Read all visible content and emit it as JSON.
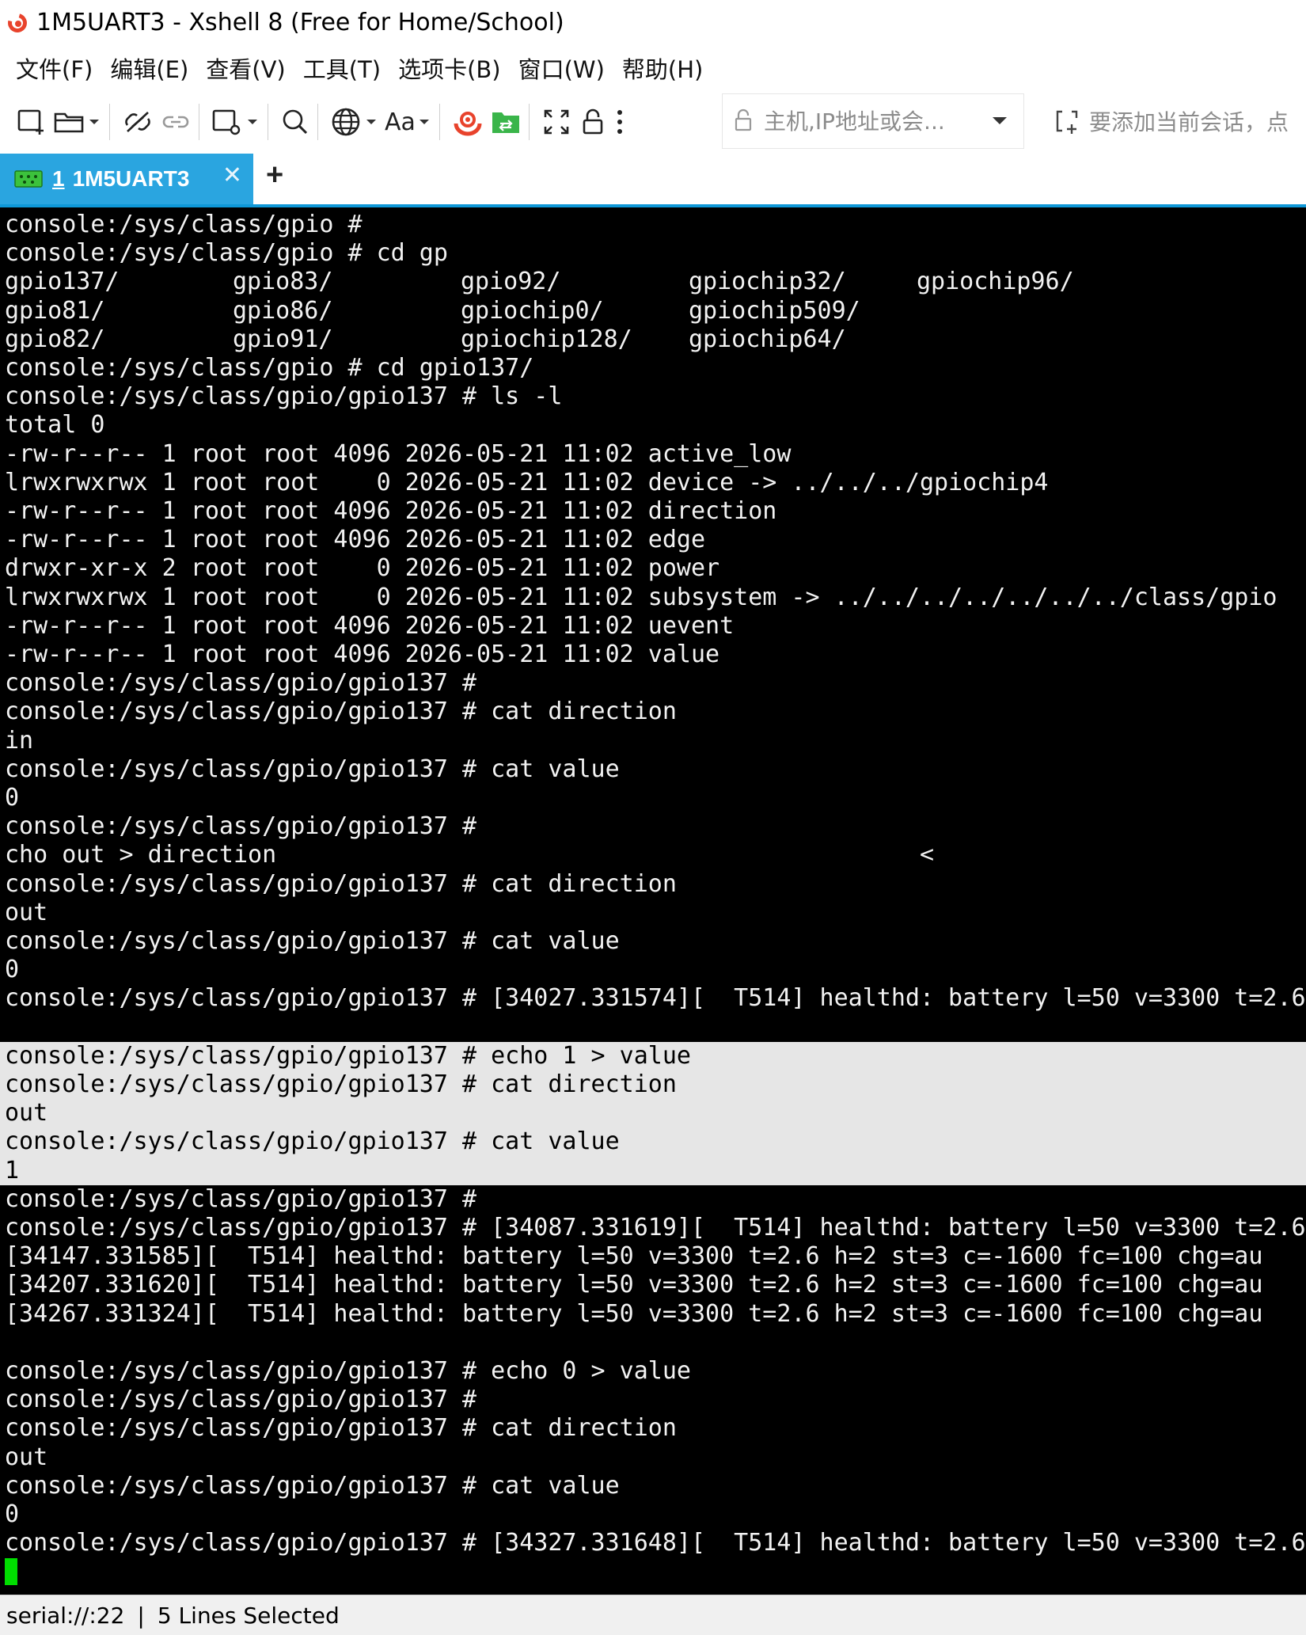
{
  "window": {
    "title": "1M5UART3 - Xshell 8 (Free for Home/School)"
  },
  "menu": [
    "文件(F)",
    "编辑(E)",
    "查看(V)",
    "工具(T)",
    "选项卡(B)",
    "窗口(W)",
    "帮助(H)"
  ],
  "toolbar": {
    "font_label": "Aa",
    "host_placeholder": "主机,IP地址或会...",
    "hint": "要添加当前会话，点"
  },
  "tabs": [
    {
      "number": "1",
      "label": "1M5UART3"
    }
  ],
  "terminal": {
    "ls_rows": [
      [
        "gpio137/",
        "gpio83/",
        "gpio92/",
        "gpiochip32/",
        "gpiochip96/"
      ],
      [
        "gpio81/",
        "gpio86/",
        "gpiochip0/",
        "gpiochip509/",
        ""
      ],
      [
        "gpio82/",
        "gpio91/",
        "gpiochip128/",
        "gpiochip64/",
        ""
      ]
    ],
    "lines_top": [
      "console:/sys/class/gpio #",
      "console:/sys/class/gpio # cd gp"
    ],
    "lines_mid": [
      "console:/sys/class/gpio # cd gpio137/",
      "console:/sys/class/gpio/gpio137 # ls -l",
      "total 0",
      "-rw-r--r-- 1 root root 4096 2026-05-21 11:02 active_low",
      "lrwxrwxrwx 1 root root    0 2026-05-21 11:02 device -> ../../../gpiochip4",
      "-rw-r--r-- 1 root root 4096 2026-05-21 11:02 direction",
      "-rw-r--r-- 1 root root 4096 2026-05-21 11:02 edge",
      "drwxr-xr-x 2 root root    0 2026-05-21 11:02 power",
      "lrwxrwxrwx 1 root root    0 2026-05-21 11:02 subsystem -> ../../../../../../../class/gpio",
      "-rw-r--r-- 1 root root 4096 2026-05-21 11:02 uevent",
      "-rw-r--r-- 1 root root 4096 2026-05-21 11:02 value",
      "console:/sys/class/gpio/gpio137 #",
      "console:/sys/class/gpio/gpio137 # cat direction",
      "in",
      "console:/sys/class/gpio/gpio137 # cat value",
      "0",
      "console:/sys/class/gpio/gpio137 #",
      "cho out > direction                                             <",
      "console:/sys/class/gpio/gpio137 # cat direction",
      "out",
      "console:/sys/class/gpio/gpio137 # cat value",
      "0",
      "console:/sys/class/gpio/gpio137 # [34027.331574][  T514] healthd: battery l=50 v=3300 t=2.6",
      ""
    ],
    "lines_selected": [
      "console:/sys/class/gpio/gpio137 # echo 1 > value",
      "console:/sys/class/gpio/gpio137 # cat direction",
      "out",
      "console:/sys/class/gpio/gpio137 # cat value",
      "1"
    ],
    "lines_bottom": [
      "console:/sys/class/gpio/gpio137 #",
      "console:/sys/class/gpio/gpio137 # [34087.331619][  T514] healthd: battery l=50 v=3300 t=2.6",
      "[34147.331585][  T514] healthd: battery l=50 v=3300 t=2.6 h=2 st=3 c=-1600 fc=100 chg=au",
      "[34207.331620][  T514] healthd: battery l=50 v=3300 t=2.6 h=2 st=3 c=-1600 fc=100 chg=au",
      "[34267.331324][  T514] healthd: battery l=50 v=3300 t=2.6 h=2 st=3 c=-1600 fc=100 chg=au",
      "",
      "console:/sys/class/gpio/gpio137 # echo 0 > value",
      "console:/sys/class/gpio/gpio137 #",
      "console:/sys/class/gpio/gpio137 # cat direction",
      "out",
      "console:/sys/class/gpio/gpio137 # cat value",
      "0",
      "console:/sys/class/gpio/gpio137 # [34327.331648][  T514] healthd: battery l=50 v=3300 t=2.6"
    ]
  },
  "status": {
    "connection": "serial://:22",
    "separator": "|",
    "selection": "5 Lines Selected"
  },
  "colors": {
    "tab_active": "#2aa5e0",
    "tab_border": "#0e98d8",
    "terminal_bg": "#000000",
    "terminal_fg": "#f2f2f2",
    "selection_bg": "#e6e6e6",
    "cursor": "#00dd00",
    "logo": "#e8432c"
  }
}
